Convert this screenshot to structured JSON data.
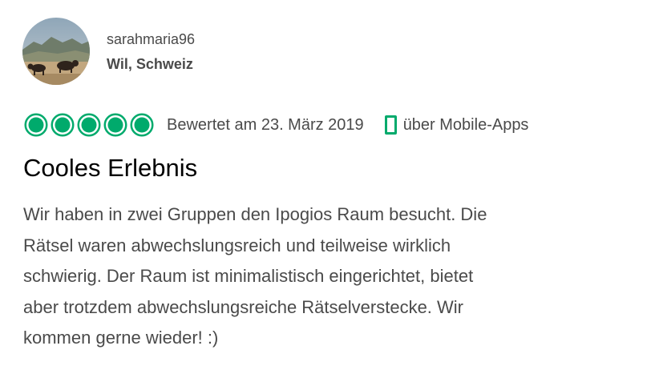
{
  "review": {
    "user": {
      "username": "sarahmaria96",
      "location": "Wil, Schweiz"
    },
    "rating": {
      "bubbles_filled": 5,
      "bubbles_total": 5,
      "color": "#00aa6c"
    },
    "date_text": "Bewertet am 23. März 2019",
    "source_icon": "mobile-phone-icon",
    "source_text": "über Mobile-Apps",
    "title": "Cooles Erlebnis",
    "body_lines": [
      "Wir haben in zwei Gruppen den Ipogios Raum besucht. Die",
      "Rätsel waren abwechslungsreich und teilweise wirklich",
      "schwierig. Der Raum ist minimalistisch eingerichtet, bietet",
      "aber trotzdem abwechslungsreiche Rätselverstecke. Wir",
      "kommen gerne wieder! :)"
    ]
  }
}
